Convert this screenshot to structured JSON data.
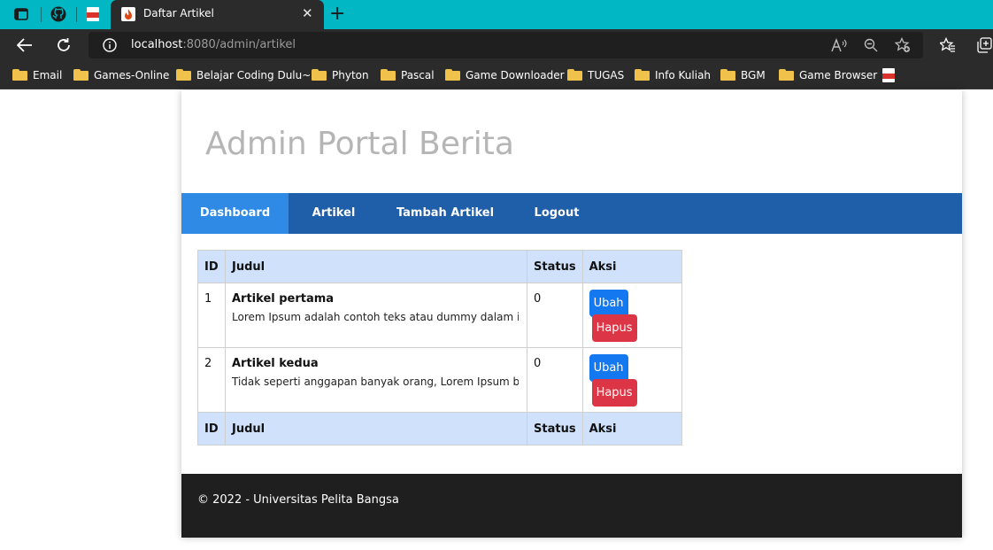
{
  "browser": {
    "active_tab_title": "Daftar Artikel",
    "close_glyph": "✕",
    "new_tab_glyph": "+",
    "url_host": "localhost",
    "url_rest": ":8080/admin/artikel",
    "bookmarks": [
      {
        "label": "Email",
        "icon": "folder-icon"
      },
      {
        "label": "Games-Online",
        "icon": "folder-icon"
      },
      {
        "label": "Belajar Coding Dulu~",
        "icon": "folder-icon"
      },
      {
        "label": "Phyton",
        "icon": "folder-icon"
      },
      {
        "label": "Pascal",
        "icon": "folder-icon"
      },
      {
        "label": "Game Downloader",
        "icon": "folder-icon"
      },
      {
        "label": "TUGAS",
        "icon": "folder-icon"
      },
      {
        "label": "Info Kuliah",
        "icon": "folder-icon"
      },
      {
        "label": "BGM",
        "icon": "folder-icon"
      },
      {
        "label": "Game Browser",
        "icon": "folder-icon"
      }
    ]
  },
  "site": {
    "title": "Admin Portal Berita",
    "nav": {
      "dashboard": "Dashboard",
      "artikel": "Artikel",
      "tambah": "Tambah Artikel",
      "logout": "Logout"
    },
    "table": {
      "headers": {
        "id": "ID",
        "judul": "Judul",
        "status": "Status",
        "aksi": "Aksi"
      },
      "rows": [
        {
          "id": "1",
          "judul": "Artikel pertama",
          "isi": "Lorem Ipsum adalah contoh teks atau dummy dalam in",
          "status": "0",
          "ubah": "Ubah",
          "hapus": "Hapus"
        },
        {
          "id": "2",
          "judul": "Artikel kedua",
          "isi": "Tidak seperti anggapan banyak orang, Lorem Ipsum b",
          "status": "0",
          "ubah": "Ubah",
          "hapus": "Hapus"
        }
      ]
    },
    "footer": "© 2022 - Universitas Pelita Bangsa"
  },
  "colors": {
    "tabbar": "#00b7c3",
    "chrome": "#2b2b2b",
    "nav": "#1f5ea8",
    "nav_active": "#2f8ae5",
    "table_head": "#cfe1fb",
    "btn_ubah": "#1478f0",
    "btn_hapus": "#dc3545",
    "footer": "#1f1f1f"
  }
}
